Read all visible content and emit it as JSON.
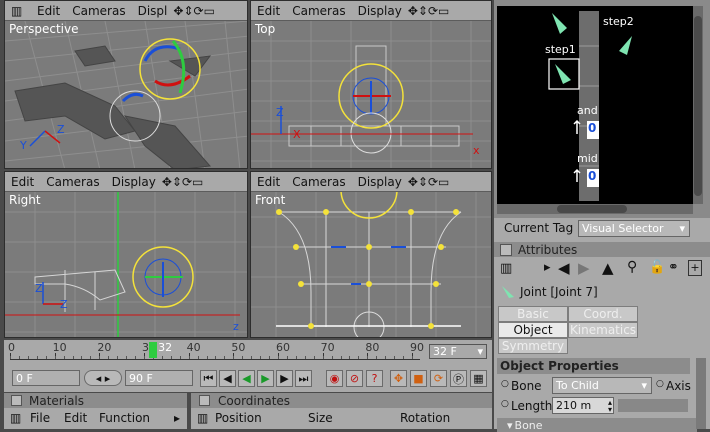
{
  "viewports": {
    "perspective": {
      "name": "Perspective",
      "menu": [
        "Edit",
        "Cameras",
        "Displ"
      ]
    },
    "top": {
      "name": "Top",
      "menu": [
        "Edit",
        "Cameras",
        "Display"
      ]
    },
    "right": {
      "name": "Right",
      "menu": [
        "Edit",
        "Cameras",
        "Display"
      ]
    },
    "front": {
      "name": "Front",
      "menu": [
        "Edit",
        "Cameras",
        "Display"
      ]
    }
  },
  "xpresso": {
    "nodes": {
      "step1": "step1",
      "step2": "step2",
      "and": "and",
      "mid": "mid"
    },
    "port_value": "0"
  },
  "current_tag": {
    "label": "Current Tag",
    "value": "Visual Selector"
  },
  "attributes": {
    "title": "Attributes",
    "object_name": "Joint [Joint 7]",
    "tabs": [
      "Basic",
      "Coord.",
      "Object",
      "Kinematics",
      "Symmetry"
    ],
    "active_tab": "Object",
    "section": "Object Properties",
    "bone_label": "Bone",
    "bone_value": "To Child",
    "axis_label": "Axis",
    "length_label": "Length",
    "length_value": "210 m",
    "subsection": "Bone"
  },
  "timeline": {
    "ticks": [
      "0",
      "10",
      "20",
      "30",
      "32",
      "40",
      "50",
      "60",
      "70",
      "80",
      "90"
    ],
    "current_frame": "32",
    "frame_field": "32 F",
    "start_field": "0 F",
    "end_field": "90 F",
    "progress": 0.356
  },
  "materials": {
    "title": "Materials",
    "menu": [
      "File",
      "Edit",
      "Function"
    ]
  },
  "coordinates": {
    "title": "Coordinates",
    "columns": [
      "Position",
      "Size",
      "Rotation"
    ]
  },
  "colors": {
    "viewport": "#7b7b7b",
    "panel": "#a9a9a9",
    "accent_green": "#2ecc40",
    "axis_red": "#d01010",
    "axis_blue": "#1a4fd8",
    "gizmo_yellow": "#f4e23a",
    "selection": "#2f4bbd"
  }
}
